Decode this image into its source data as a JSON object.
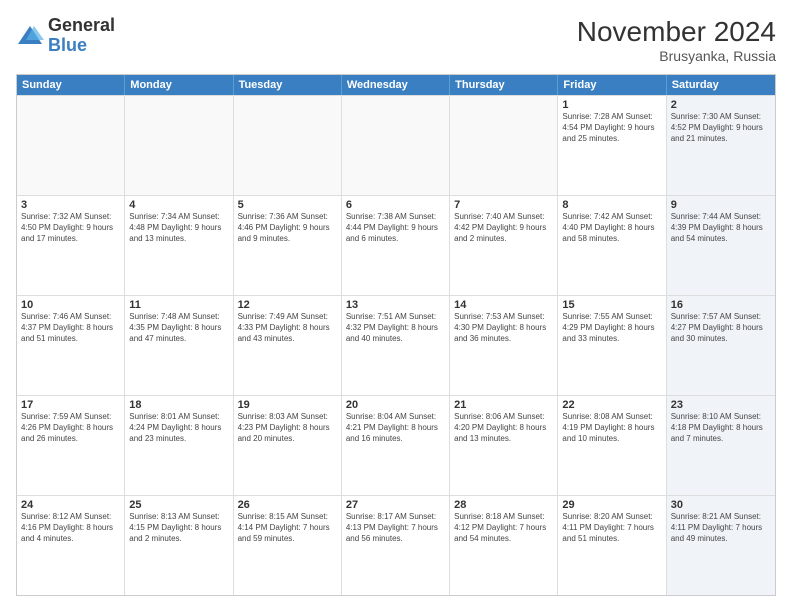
{
  "logo": {
    "general": "General",
    "blue": "Blue"
  },
  "title": "November 2024",
  "location": "Brusyanka, Russia",
  "days_of_week": [
    "Sunday",
    "Monday",
    "Tuesday",
    "Wednesday",
    "Thursday",
    "Friday",
    "Saturday"
  ],
  "weeks": [
    [
      {
        "day": "",
        "info": "",
        "shaded": false,
        "empty": true
      },
      {
        "day": "",
        "info": "",
        "shaded": false,
        "empty": true
      },
      {
        "day": "",
        "info": "",
        "shaded": false,
        "empty": true
      },
      {
        "day": "",
        "info": "",
        "shaded": false,
        "empty": true
      },
      {
        "day": "",
        "info": "",
        "shaded": false,
        "empty": true
      },
      {
        "day": "1",
        "info": "Sunrise: 7:28 AM\nSunset: 4:54 PM\nDaylight: 9 hours\nand 25 minutes.",
        "shaded": false,
        "empty": false
      },
      {
        "day": "2",
        "info": "Sunrise: 7:30 AM\nSunset: 4:52 PM\nDaylight: 9 hours\nand 21 minutes.",
        "shaded": true,
        "empty": false
      }
    ],
    [
      {
        "day": "3",
        "info": "Sunrise: 7:32 AM\nSunset: 4:50 PM\nDaylight: 9 hours\nand 17 minutes.",
        "shaded": false,
        "empty": false
      },
      {
        "day": "4",
        "info": "Sunrise: 7:34 AM\nSunset: 4:48 PM\nDaylight: 9 hours\nand 13 minutes.",
        "shaded": false,
        "empty": false
      },
      {
        "day": "5",
        "info": "Sunrise: 7:36 AM\nSunset: 4:46 PM\nDaylight: 9 hours\nand 9 minutes.",
        "shaded": false,
        "empty": false
      },
      {
        "day": "6",
        "info": "Sunrise: 7:38 AM\nSunset: 4:44 PM\nDaylight: 9 hours\nand 6 minutes.",
        "shaded": false,
        "empty": false
      },
      {
        "day": "7",
        "info": "Sunrise: 7:40 AM\nSunset: 4:42 PM\nDaylight: 9 hours\nand 2 minutes.",
        "shaded": false,
        "empty": false
      },
      {
        "day": "8",
        "info": "Sunrise: 7:42 AM\nSunset: 4:40 PM\nDaylight: 8 hours\nand 58 minutes.",
        "shaded": false,
        "empty": false
      },
      {
        "day": "9",
        "info": "Sunrise: 7:44 AM\nSunset: 4:39 PM\nDaylight: 8 hours\nand 54 minutes.",
        "shaded": true,
        "empty": false
      }
    ],
    [
      {
        "day": "10",
        "info": "Sunrise: 7:46 AM\nSunset: 4:37 PM\nDaylight: 8 hours\nand 51 minutes.",
        "shaded": false,
        "empty": false
      },
      {
        "day": "11",
        "info": "Sunrise: 7:48 AM\nSunset: 4:35 PM\nDaylight: 8 hours\nand 47 minutes.",
        "shaded": false,
        "empty": false
      },
      {
        "day": "12",
        "info": "Sunrise: 7:49 AM\nSunset: 4:33 PM\nDaylight: 8 hours\nand 43 minutes.",
        "shaded": false,
        "empty": false
      },
      {
        "day": "13",
        "info": "Sunrise: 7:51 AM\nSunset: 4:32 PM\nDaylight: 8 hours\nand 40 minutes.",
        "shaded": false,
        "empty": false
      },
      {
        "day": "14",
        "info": "Sunrise: 7:53 AM\nSunset: 4:30 PM\nDaylight: 8 hours\nand 36 minutes.",
        "shaded": false,
        "empty": false
      },
      {
        "day": "15",
        "info": "Sunrise: 7:55 AM\nSunset: 4:29 PM\nDaylight: 8 hours\nand 33 minutes.",
        "shaded": false,
        "empty": false
      },
      {
        "day": "16",
        "info": "Sunrise: 7:57 AM\nSunset: 4:27 PM\nDaylight: 8 hours\nand 30 minutes.",
        "shaded": true,
        "empty": false
      }
    ],
    [
      {
        "day": "17",
        "info": "Sunrise: 7:59 AM\nSunset: 4:26 PM\nDaylight: 8 hours\nand 26 minutes.",
        "shaded": false,
        "empty": false
      },
      {
        "day": "18",
        "info": "Sunrise: 8:01 AM\nSunset: 4:24 PM\nDaylight: 8 hours\nand 23 minutes.",
        "shaded": false,
        "empty": false
      },
      {
        "day": "19",
        "info": "Sunrise: 8:03 AM\nSunset: 4:23 PM\nDaylight: 8 hours\nand 20 minutes.",
        "shaded": false,
        "empty": false
      },
      {
        "day": "20",
        "info": "Sunrise: 8:04 AM\nSunset: 4:21 PM\nDaylight: 8 hours\nand 16 minutes.",
        "shaded": false,
        "empty": false
      },
      {
        "day": "21",
        "info": "Sunrise: 8:06 AM\nSunset: 4:20 PM\nDaylight: 8 hours\nand 13 minutes.",
        "shaded": false,
        "empty": false
      },
      {
        "day": "22",
        "info": "Sunrise: 8:08 AM\nSunset: 4:19 PM\nDaylight: 8 hours\nand 10 minutes.",
        "shaded": false,
        "empty": false
      },
      {
        "day": "23",
        "info": "Sunrise: 8:10 AM\nSunset: 4:18 PM\nDaylight: 8 hours\nand 7 minutes.",
        "shaded": true,
        "empty": false
      }
    ],
    [
      {
        "day": "24",
        "info": "Sunrise: 8:12 AM\nSunset: 4:16 PM\nDaylight: 8 hours\nand 4 minutes.",
        "shaded": false,
        "empty": false
      },
      {
        "day": "25",
        "info": "Sunrise: 8:13 AM\nSunset: 4:15 PM\nDaylight: 8 hours\nand 2 minutes.",
        "shaded": false,
        "empty": false
      },
      {
        "day": "26",
        "info": "Sunrise: 8:15 AM\nSunset: 4:14 PM\nDaylight: 7 hours\nand 59 minutes.",
        "shaded": false,
        "empty": false
      },
      {
        "day": "27",
        "info": "Sunrise: 8:17 AM\nSunset: 4:13 PM\nDaylight: 7 hours\nand 56 minutes.",
        "shaded": false,
        "empty": false
      },
      {
        "day": "28",
        "info": "Sunrise: 8:18 AM\nSunset: 4:12 PM\nDaylight: 7 hours\nand 54 minutes.",
        "shaded": false,
        "empty": false
      },
      {
        "day": "29",
        "info": "Sunrise: 8:20 AM\nSunset: 4:11 PM\nDaylight: 7 hours\nand 51 minutes.",
        "shaded": false,
        "empty": false
      },
      {
        "day": "30",
        "info": "Sunrise: 8:21 AM\nSunset: 4:11 PM\nDaylight: 7 hours\nand 49 minutes.",
        "shaded": true,
        "empty": false
      }
    ]
  ]
}
